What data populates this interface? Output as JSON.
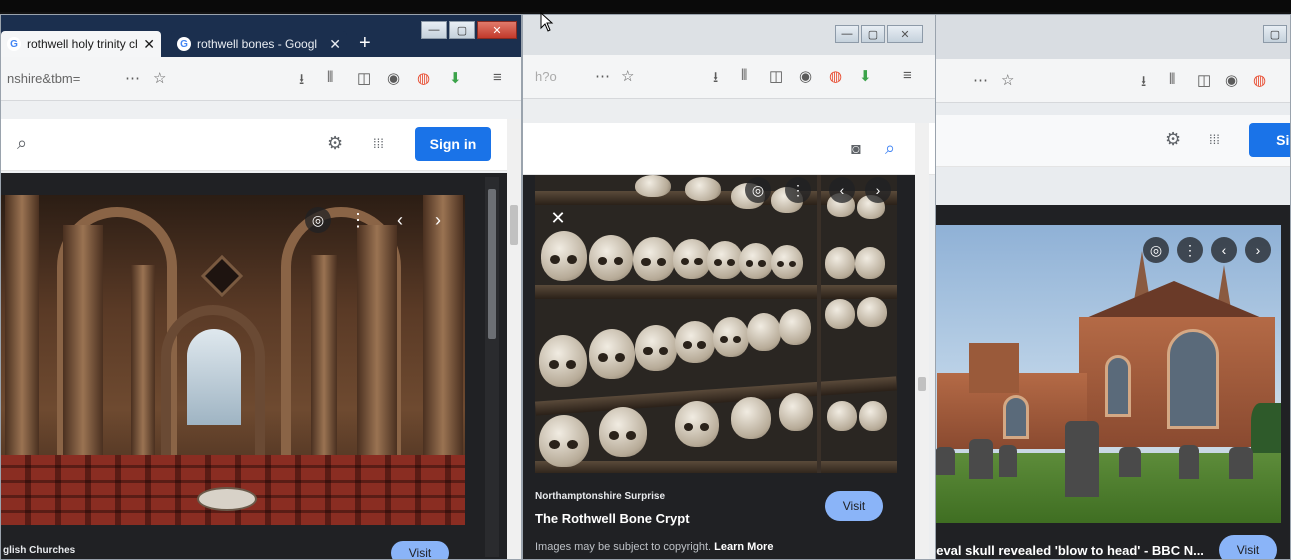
{
  "win1": {
    "tabs": [
      {
        "title": "rothwell holy trinity ch",
        "favicon": "G"
      },
      {
        "title": "rothwell bones - Googl",
        "favicon": "G"
      }
    ],
    "new_tab": "+",
    "url": "nshire&tbm=",
    "sign_in": "Sign in",
    "caption_title": "glish Churches",
    "visit": "Visit"
  },
  "win2": {
    "url": "h?o",
    "source": "Northamptonshire Surprise",
    "title": "The Rothwell Bone Crypt",
    "visit": "Visit",
    "copyright": "Images may be subject to copyright.",
    "learn_more": "Learn More",
    "close_label": "✕"
  },
  "win3": {
    "sign_in": "Sig",
    "caption_title": "lieval skull revealed 'blow to head' - BBC N...",
    "visit": "Visit"
  },
  "icons": {
    "more": "⋯",
    "star": "☆",
    "download": "⭳",
    "library": "⫴",
    "sidebar": "◫",
    "account": "◉",
    "addon_red": "◍",
    "addon_green": "⬇",
    "menu": "≡",
    "search": "⌕",
    "gear": "⚙",
    "apps": "⁞⁞⁞",
    "camera": "◙",
    "lens": "◎",
    "dots": "⋮",
    "prev": "‹",
    "next": "›",
    "close": "✕",
    "minimize": "—",
    "maximize": "▢"
  },
  "colors": {
    "google_blue": "#1a73e8",
    "visit_blue": "#8ab4f8",
    "tab_dark": "#1b2f4e",
    "panel": "#202124"
  }
}
